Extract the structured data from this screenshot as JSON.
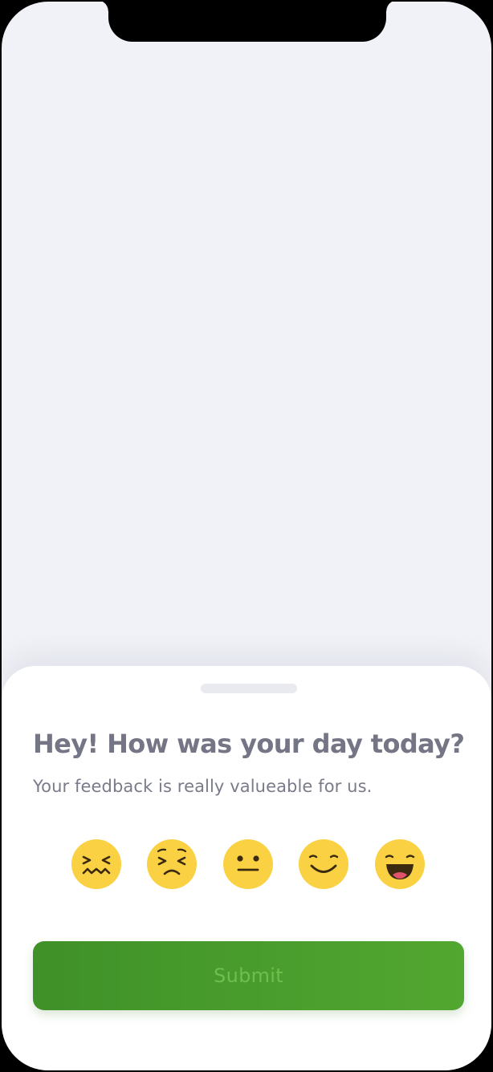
{
  "feedback_sheet": {
    "title": "Hey! How was your day today?",
    "subtitle": "Your feedback is really valueable for us.",
    "submit_label": "Submit",
    "emoji_color": "#f9d142",
    "submit_color": "#47a02d"
  },
  "moods": [
    {
      "name": "confounded-face-icon"
    },
    {
      "name": "persevering-face-icon"
    },
    {
      "name": "neutral-face-icon"
    },
    {
      "name": "smiling-face-icon"
    },
    {
      "name": "grinning-face-icon"
    }
  ]
}
